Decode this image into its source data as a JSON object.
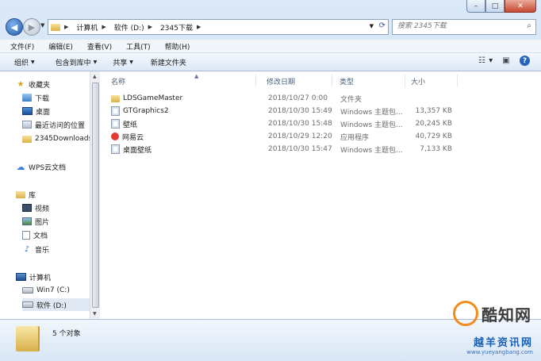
{
  "window": {
    "caption_buttons": [
      "–",
      "□",
      "✕"
    ]
  },
  "address": {
    "crumbs": [
      "计算机",
      "软件 (D:)",
      "2345下载"
    ],
    "search_placeholder": "搜索 2345下载"
  },
  "menu": {
    "items": [
      "文件(F)",
      "编辑(E)",
      "查看(V)",
      "工具(T)",
      "帮助(H)"
    ]
  },
  "commands": {
    "organize": "组织",
    "include_library": "包含到库中",
    "share": "共享",
    "new_folder": "新建文件夹"
  },
  "nav": {
    "favorites": "收藏夹",
    "downloads": "下载",
    "desktop": "桌面",
    "recent": "最近访问的位置",
    "folder_2345": "2345Downloads",
    "wps_cloud": "WPS云文档",
    "libraries": "库",
    "videos": "视频",
    "pictures": "图片",
    "documents": "文档",
    "music": "音乐",
    "computer": "计算机",
    "drive_c": "Win7 (C:)",
    "drive_d": "软件 (D:)"
  },
  "columns": {
    "name": "名称",
    "date": "修改日期",
    "type": "类型",
    "size": "大小"
  },
  "files": [
    {
      "name": "LDSGameMaster",
      "date": "2018/10/27 0:00",
      "type": "文件夹",
      "size": "",
      "icon": "folder-icon"
    },
    {
      "name": "GTGraphics2",
      "date": "2018/10/30 15:49",
      "type": "Windows 主题包...",
      "size": "13,357 KB",
      "icon": "theme-file-icon"
    },
    {
      "name": "壁纸",
      "date": "2018/10/30 15:48",
      "type": "Windows 主题包...",
      "size": "20,245 KB",
      "icon": "theme-file-icon"
    },
    {
      "name": "网易云",
      "date": "2018/10/29 12:20",
      "type": "应用程序",
      "size": "40,729 KB",
      "icon": "app-icon"
    },
    {
      "name": "桌面壁纸",
      "date": "2018/10/30 15:47",
      "type": "Windows 主题包...",
      "size": "7,133 KB",
      "icon": "theme-file-icon"
    }
  ],
  "status": {
    "count": "5 个对象"
  },
  "watermark": {
    "brand": "酷知网",
    "site_name": "越羊资讯网",
    "site_url": "www.yueyangbang.com"
  }
}
